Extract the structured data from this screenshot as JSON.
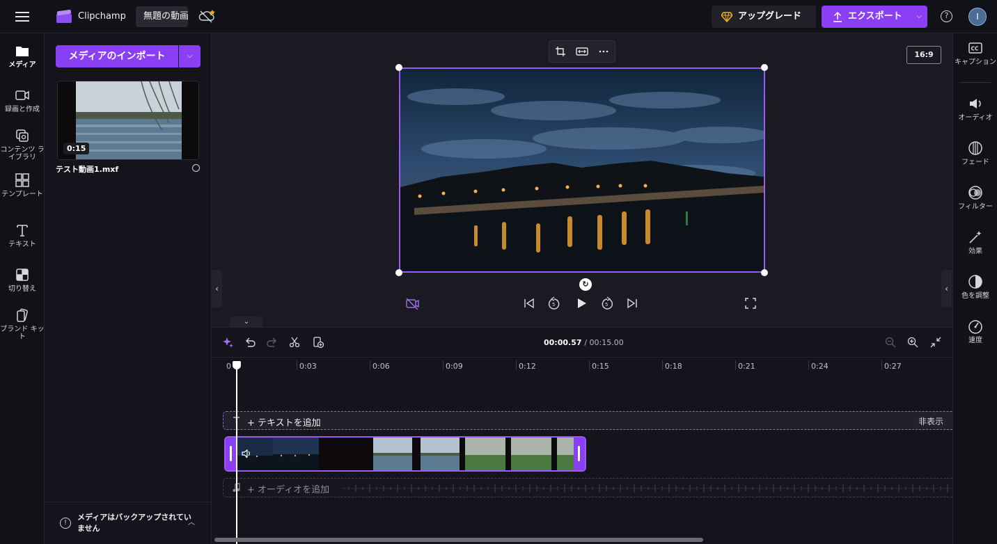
{
  "topbar": {
    "app_name": "Clipchamp",
    "project_title": "無題の動画",
    "upgrade_label": "アップグレード",
    "export_label": "エクスポート",
    "help_glyph": "?",
    "avatar_initial": "I"
  },
  "leftnav": {
    "items": [
      {
        "label": "メディア",
        "icon": "folder-icon"
      },
      {
        "label": "録画と作成",
        "icon": "video-camera-icon"
      },
      {
        "label": "コンテンツ ライブラリ",
        "icon": "library-icon"
      },
      {
        "label": "テンプレート",
        "icon": "templates-icon"
      },
      {
        "label": "テキスト",
        "icon": "text-icon"
      },
      {
        "label": "切り替え",
        "icon": "transitions-icon"
      },
      {
        "label": "ブランド キット",
        "icon": "brand-kit-icon"
      }
    ]
  },
  "media": {
    "import_label": "メディアのインポート",
    "file_name": "テスト動画1.mxf",
    "file_duration": "0:15",
    "backup_message": "メディアはバックアップされていません"
  },
  "preview": {
    "aspect_ratio": "16:9"
  },
  "timeline": {
    "current_time": "00:00.57",
    "total_time": "/ 00:15.00",
    "ticks": [
      "0",
      "0:03",
      "0:06",
      "0:09",
      "0:12",
      "0:15",
      "0:18",
      "0:21",
      "0:24",
      "0:27"
    ],
    "add_text": "+ テキストを追加",
    "hide_label": "非表示",
    "add_audio": "+ オーディオを追加"
  },
  "rightpanel": {
    "items": [
      {
        "label": "キャプション",
        "icon": "captions-icon"
      },
      {
        "label": "オーディオ",
        "icon": "speaker-icon"
      },
      {
        "label": "フェード",
        "icon": "fade-icon"
      },
      {
        "label": "フィルター",
        "icon": "filter-icon"
      },
      {
        "label": "効果",
        "icon": "magic-wand-icon"
      },
      {
        "label": "色を調整",
        "icon": "color-adjust-icon"
      },
      {
        "label": "速度",
        "icon": "speed-gauge-icon"
      }
    ]
  },
  "colors": {
    "accent": "#8a3ff5",
    "selection": "#9b59f5",
    "background": "#1b1a23",
    "panel": "#111118"
  }
}
